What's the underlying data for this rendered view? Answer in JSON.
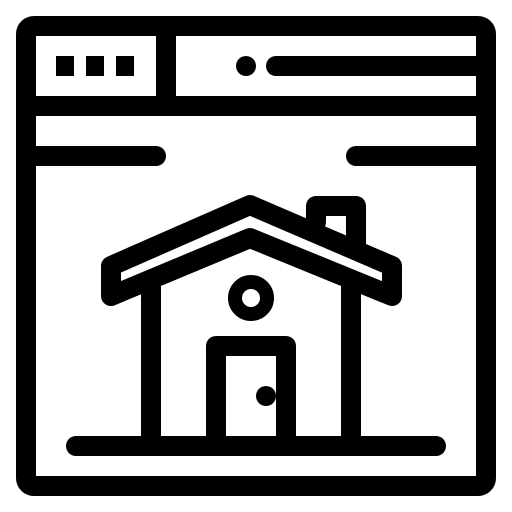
{
  "icon": {
    "name": "home-webpage-icon",
    "stroke_color": "#000000",
    "fill_color": "#ffffff",
    "parts": [
      "browser-window-frame-icon",
      "window-controls-icon",
      "address-bar-icon",
      "house-icon",
      "chimney-icon",
      "round-window-icon",
      "door-icon",
      "door-knob-icon",
      "ground-line-icon"
    ]
  }
}
